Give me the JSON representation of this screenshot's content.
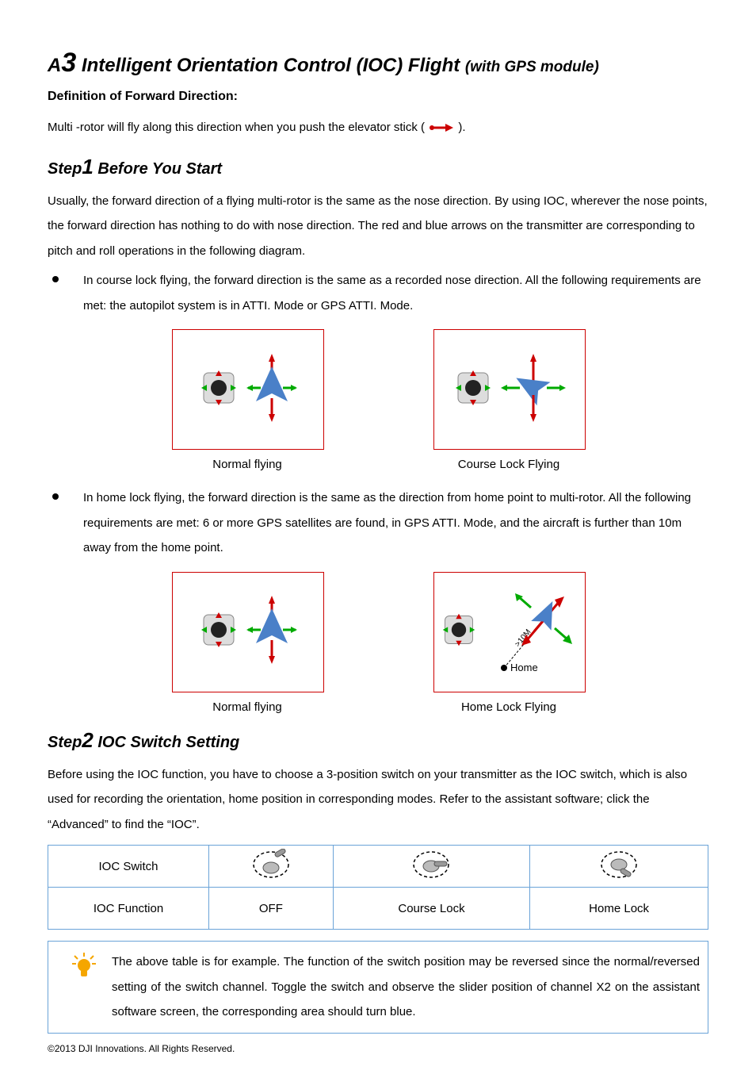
{
  "header": {
    "prefix": "A",
    "number": "3",
    "title_rest": " Intelligent Orientation Control (IOC) Flight ",
    "paren": "(with GPS module)"
  },
  "definition_label": "Definition of Forward Direction:",
  "definition_body_pre": "Multi -rotor will fly along this direction when you push the elevator stick ( ",
  "definition_body_post": " ).",
  "step1": {
    "prefix": "Step",
    "number": "1",
    "title": " Before You Start",
    "intro": "Usually, the forward direction of a flying multi-rotor is the same as the nose direction. By using IOC, wherever the nose points, the forward direction has nothing to do with nose direction. The red and blue arrows on the transmitter are corresponding to pitch and roll operations in the following diagram.",
    "bullet1": "In course lock flying, the forward direction is the same as a recorded nose direction. All the following requirements are met: the autopilot system is in ATTI. Mode or GPS ATTI. Mode.",
    "captions1": {
      "left": "Normal flying",
      "right": "Course Lock Flying"
    },
    "bullet2": "In home lock flying, the forward direction is the same as the direction from home point to multi-rotor. All the following requirements are met: 6 or more GPS satellites are found, in GPS ATTI. Mode, and the aircraft is further than 10m away from the home point.",
    "captions2": {
      "left": "Normal flying",
      "right": "Home Lock Flying"
    },
    "home_marker": "Home",
    "home_distance": ">10M"
  },
  "step2": {
    "prefix": "Step",
    "number": "2",
    "title": " IOC Switch Setting",
    "intro": "Before using the IOC function, you have to choose a 3-position switch on your transmitter as the IOC switch, which is also used for recording the orientation, home position in corresponding modes. Refer to the assistant software; click the “Advanced” to find the “IOC”.",
    "table": {
      "row1_label": "IOC Switch",
      "row2_label": "IOC Function",
      "cols": [
        "OFF",
        "Course Lock",
        "Home Lock"
      ]
    },
    "note": "The above table is for example. The function of the switch position may be reversed since the normal/reversed setting of the switch channel. Toggle the switch and observe the slider position of channel X2 on the assistant software screen, the corresponding area should turn blue."
  },
  "footer": "©2013 DJI Innovations. All Rights Reserved."
}
